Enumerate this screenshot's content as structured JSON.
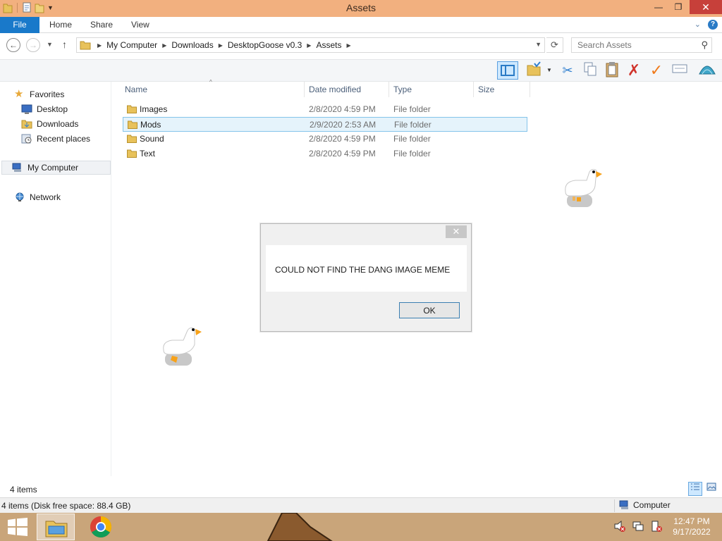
{
  "window": {
    "title": "Assets",
    "minimize_glyph": "—",
    "maximize_glyph": "❐",
    "close_glyph": "✕"
  },
  "ribbon": {
    "tabs": [
      {
        "label": "File"
      },
      {
        "label": "Home"
      },
      {
        "label": "Share"
      },
      {
        "label": "View"
      }
    ],
    "collapse_glyph": "⌄",
    "help_glyph": "?"
  },
  "address": {
    "crumbs": [
      "My Computer",
      "Downloads",
      "DesktopGoose v0.3",
      "Assets"
    ],
    "search_placeholder": "Search Assets"
  },
  "toolbar": {
    "icons": [
      "preview-pane-icon",
      "folder-check-icon",
      "cut-icon",
      "copy-icon",
      "paste-icon",
      "delete-icon",
      "checkmark-icon",
      "rename-icon",
      "shell-icon"
    ]
  },
  "navpane": {
    "favorites_label": "Favorites",
    "desktop_label": "Desktop",
    "downloads_label": "Downloads",
    "recent_label": "Recent places",
    "computer_label": "My Computer",
    "network_label": "Network"
  },
  "columns": {
    "name": "Name",
    "date": "Date modified",
    "type": "Type",
    "size": "Size"
  },
  "files": [
    {
      "name": "Images",
      "date": "2/8/2020 4:59 PM",
      "type": "File folder",
      "selected": false
    },
    {
      "name": "Mods",
      "date": "2/9/2020 2:53 AM",
      "type": "File folder",
      "selected": true
    },
    {
      "name": "Sound",
      "date": "2/8/2020 4:59 PM",
      "type": "File folder",
      "selected": false
    },
    {
      "name": "Text",
      "date": "2/8/2020 4:59 PM",
      "type": "File folder",
      "selected": false
    }
  ],
  "status": {
    "item_count": "4 items",
    "disk_info": "4 items (Disk free space: 88.4 GB)",
    "location": "Computer"
  },
  "dialog": {
    "message": "COULD NOT FIND THE DANG IMAGE MEME",
    "ok_label": "OK",
    "close_glyph": "✕"
  },
  "taskbar": {
    "time": "12:47 PM",
    "date": "9/17/2022"
  },
  "colors": {
    "titlebar": "#f2b07f",
    "file_tab": "#1979ca",
    "selection": "#e5f3fb",
    "taskbar": "#c9a57a"
  }
}
